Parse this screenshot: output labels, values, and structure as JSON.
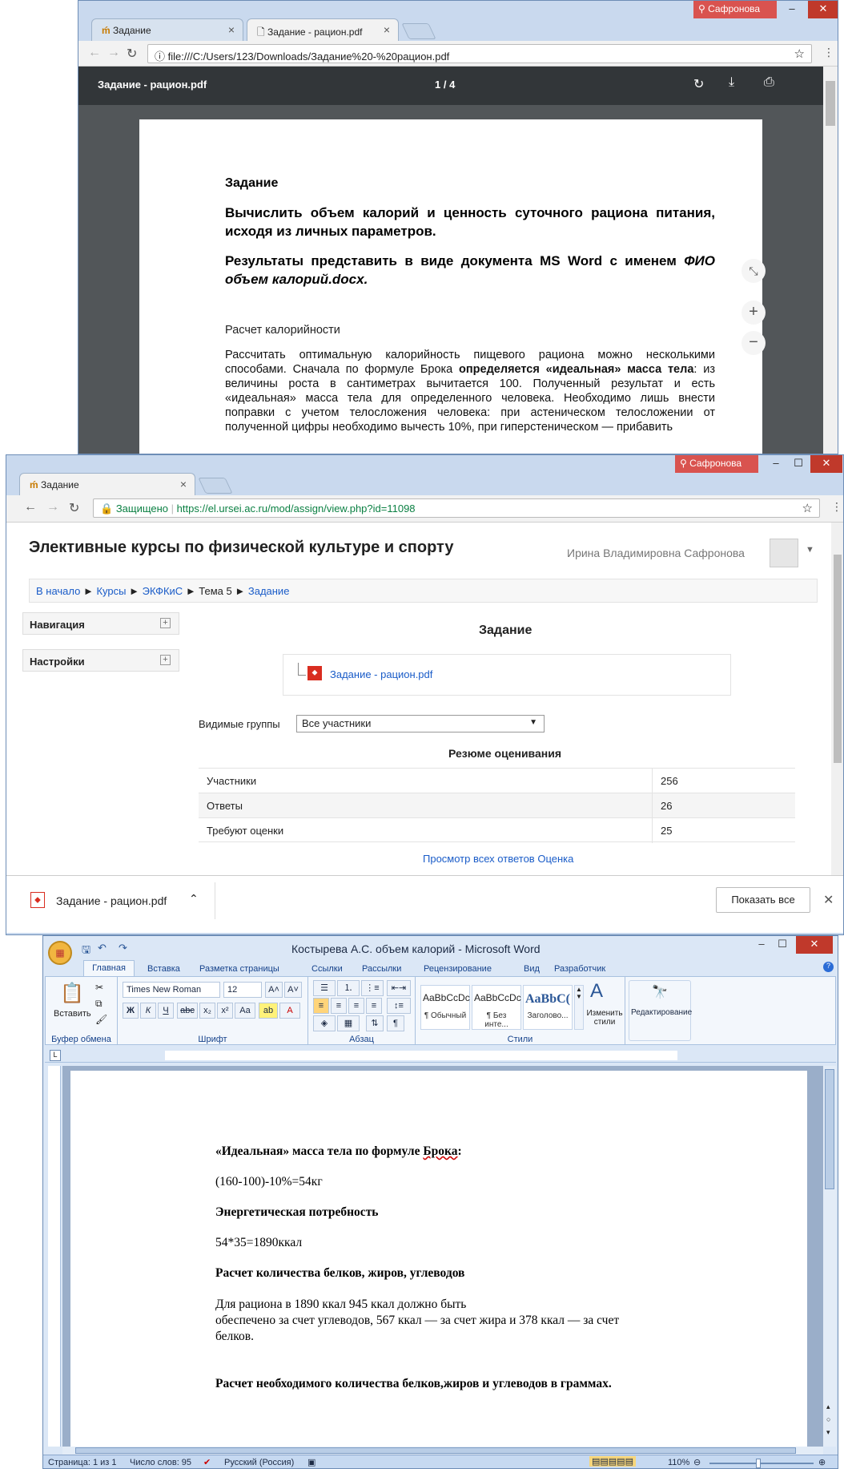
{
  "pdf_window": {
    "user_name": "Сафронова",
    "tabs": [
      {
        "label": "Задание"
      },
      {
        "label": "Задание - рацион.pdf"
      }
    ],
    "url": "file:///C:/Users/123/Downloads/Задание%20-%20рацион.pdf",
    "viewer": {
      "file_name": "Задание - рацион.pdf",
      "page_indicator": "1 / 4"
    },
    "doc": {
      "heading": "Задание",
      "para1": "Вычислить объем калорий и ценность суточного рациона питания, исходя из личных параметров.",
      "para2_a": "Результаты представить в виде документа MS Word с именем",
      "para2_b": "ФИО объем калорий.docx.",
      "subheading": "Расчет калорийности",
      "body_a": "Рассчитать оптимальную калорийность пищевого рациона можно несколькими способами. Сначала по формуле Брока",
      "body_bold": "определяется «идеальная» масса тела",
      "body_b": ": из величины роста в сантиметрах вычитается 100. Полученный результат и есть «идеальная» масса тела для определенного человека. Необходимо лишь внести поправки с учетом телосложения человека: при астеническом телосложении от полученной цифры необходимо вычесть 10%, при гиперстеническом — прибавить"
    }
  },
  "moodle_window": {
    "user_name": "Сафронова",
    "tab_label": "Задание",
    "secure_label": "Защищено",
    "url": "https://el.ursei.ac.ru/mod/assign/view.php?id=11098",
    "site_title": "Элективные курсы по физической культуре и спорту",
    "user_full_name": "Ирина Владимировна Сафронова",
    "breadcrumb": {
      "home": "В начало",
      "courses": "Курсы",
      "course": "ЭКФКиС",
      "topic": "Тема 5",
      "current": "Задание"
    },
    "blocks": {
      "navigation": "Навигация",
      "settings": "Настройки"
    },
    "page_heading": "Задание",
    "attachment": "Задание - рацион.pdf",
    "groups_label": "Видимые группы",
    "groups_value": "Все участники",
    "summary_heading": "Резюме оценивания",
    "summary_rows": [
      {
        "label": "Участники",
        "value": "256"
      },
      {
        "label": "Ответы",
        "value": "26"
      },
      {
        "label": "Требуют оценки",
        "value": "25"
      }
    ],
    "view_all": "Просмотр всех ответов",
    "grade": "Оценка",
    "download_file": "Задание - рацион.pdf",
    "show_all": "Показать все"
  },
  "word_window": {
    "title": "Костырева А.С. объем калорий - Microsoft Word",
    "tabs": [
      "Главная",
      "Вставка",
      "Разметка страницы",
      "Ссылки",
      "Рассылки",
      "Рецензирование",
      "Вид",
      "Разработчик"
    ],
    "clipboard": {
      "paste": "Вставить",
      "group": "Буфер обмена"
    },
    "font": {
      "name": "Times New Roman",
      "size": "12",
      "group": "Шрифт"
    },
    "paragraph_group": "Абзац",
    "styles": [
      {
        "preview": "AaBbCcDc",
        "name": "¶ Обычный"
      },
      {
        "preview": "AaBbCcDc",
        "name": "¶ Без инте..."
      },
      {
        "preview": "AaBbC(",
        "name": "Заголово..."
      }
    ],
    "styles_group": "Стили",
    "change_styles": "Изменить стили",
    "editing": "Редактирование",
    "doc": {
      "p1_a": "«Идеальная» масса тела по формуле ",
      "p1_b": "Брока",
      "p1_c": ":",
      "p2": "(160-100)-10%=54кг",
      "p3": "Энергетическая потребность",
      "p4": "54*35=1890ккал",
      "p5": "Расчет количества белков, жиров, углеводов",
      "p6_l1": "Для рациона в 1890 ккал 945 ккал должно быть",
      "p6_l2": "обеспечено за счет углеводов, 567 ккал — за счет жира и 378 ккал — за счет",
      "p6_l3": "белков.",
      "p7": "Расчет необходимого количества белков,жиров и углеводов в граммах."
    },
    "status": {
      "page": "Страница: 1 из 1",
      "words": "Число слов: 95",
      "language": "Русский (Россия)",
      "zoom": "110%"
    }
  }
}
